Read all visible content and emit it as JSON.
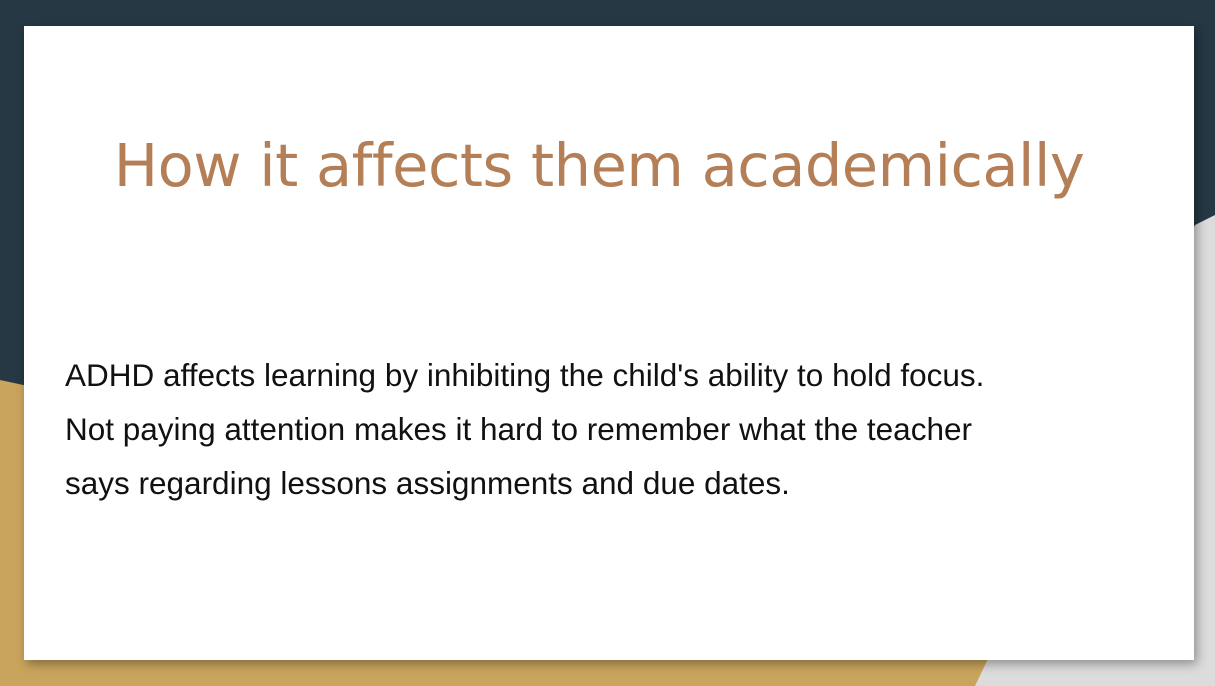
{
  "slide": {
    "title": "How it affects them academically",
    "body": "ADHD affects learning by  inhibiting the child's ability to hold focus.\nNot paying attention makes it hard to remember what the teacher\nsays regarding lessons assignments and due dates."
  },
  "colors": {
    "background_dark": "#253844",
    "background_gold": "#c9a45c",
    "background_light": "#dcdcdc",
    "title": "#b47e56",
    "body_text": "#111111",
    "card": "#ffffff"
  }
}
